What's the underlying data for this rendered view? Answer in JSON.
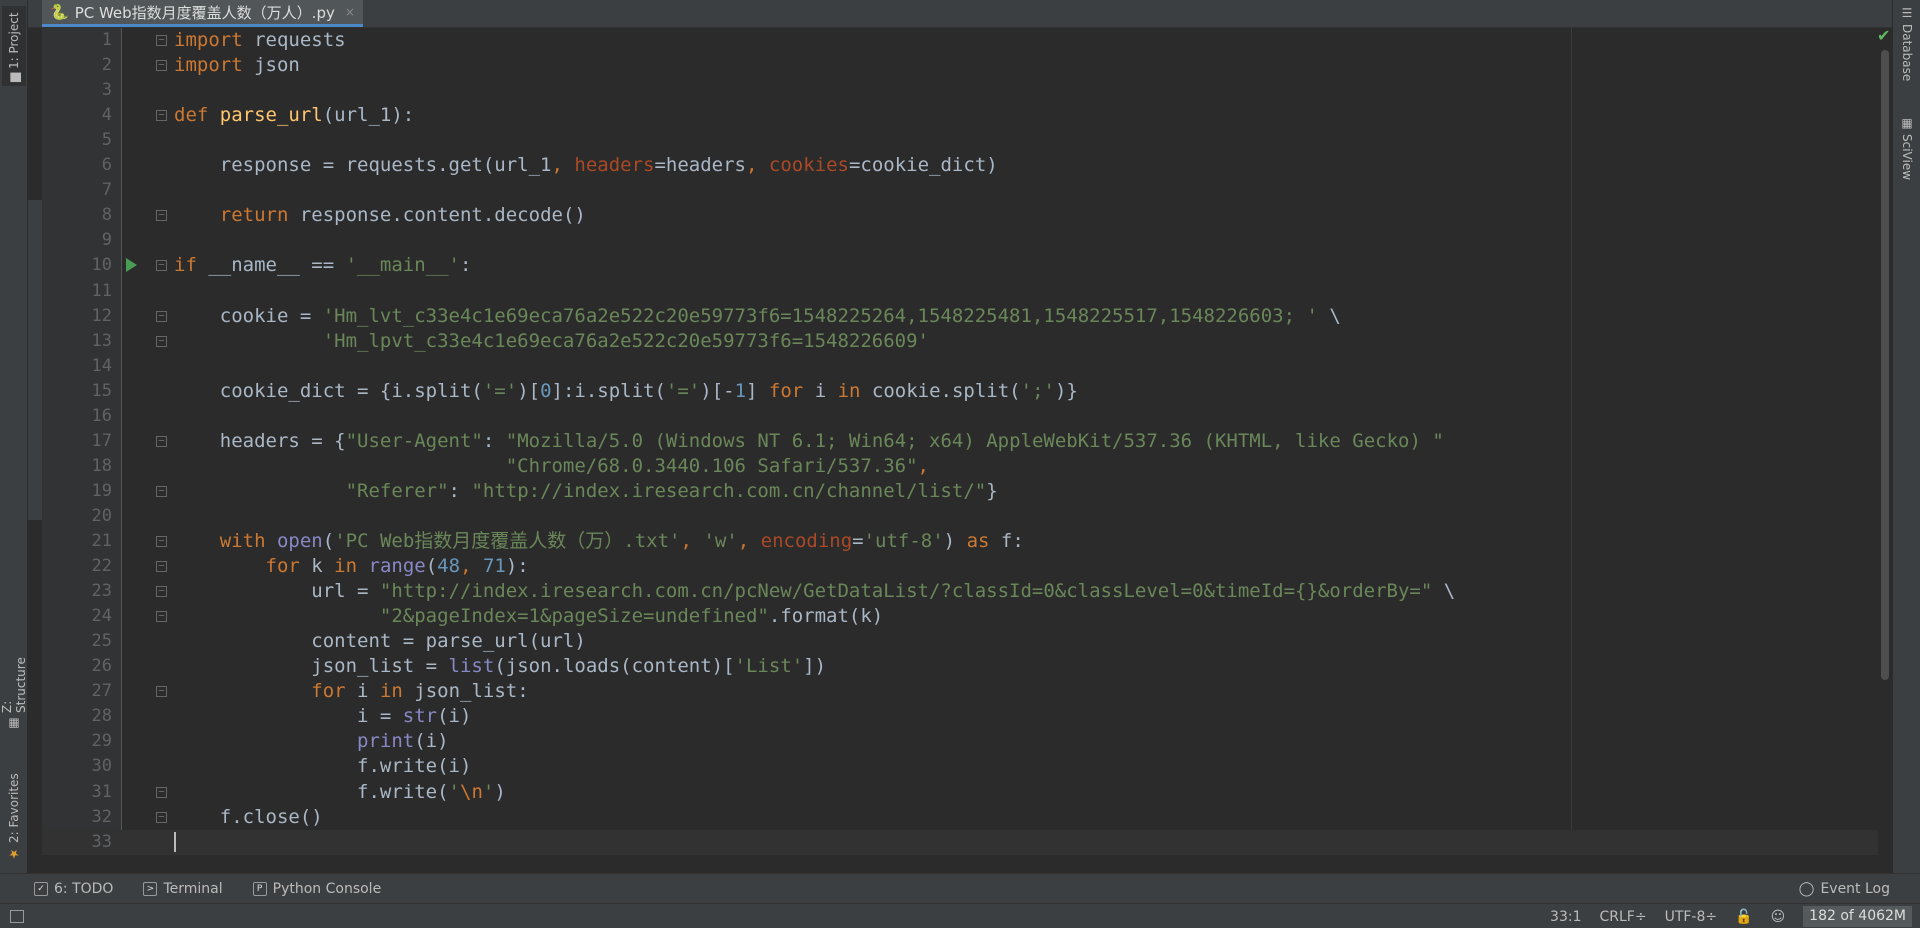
{
  "tab": {
    "title": "PC Web指数月度覆盖人数（万人）.py",
    "close": "×"
  },
  "left_tabs": {
    "project": "1: Project",
    "structure": "Z: Structure",
    "favorites": "2: Favorites"
  },
  "right_tabs": {
    "database": "Database",
    "sciview": "SciView"
  },
  "lines": [
    {
      "n": "1",
      "fold": true,
      "html": "<span class=\"kw\">import</span> requests"
    },
    {
      "n": "2",
      "fold": true,
      "html": "<span class=\"kw\">import</span> json"
    },
    {
      "n": "3",
      "html": ""
    },
    {
      "n": "4",
      "fold": true,
      "html": "<span class=\"kw\">def</span> <span class=\"fn\">parse_url</span>(url_1):"
    },
    {
      "n": "5",
      "html": ""
    },
    {
      "n": "6",
      "html": "    response = requests.get(url_1<span class=\"kw\">,</span> <span class=\"param\">headers</span>=headers<span class=\"kw\">,</span> <span class=\"param\">cookies</span>=cookie_dict)"
    },
    {
      "n": "7",
      "html": ""
    },
    {
      "n": "8",
      "fold": true,
      "html": "    <span class=\"kw\">return</span> response.content.decode()"
    },
    {
      "n": "9",
      "html": ""
    },
    {
      "n": "10",
      "fold": true,
      "run": true,
      "html": "<span class=\"kw\">if</span> __name__ == <span class=\"str\">'__main__'</span>:"
    },
    {
      "n": "11",
      "html": ""
    },
    {
      "n": "12",
      "fold": true,
      "html": "    cookie = <span class=\"str\">'Hm_lvt_c33e4c1e69eca76a2e522c20e59773f6=1548225264,1548225481,1548225517,1548226603; '</span> \\"
    },
    {
      "n": "13",
      "fold": true,
      "html": "             <span class=\"str\">'Hm_lpvt_c33e4c1e69eca76a2e522c20e59773f6=1548226609'</span>"
    },
    {
      "n": "14",
      "html": ""
    },
    {
      "n": "15",
      "html": "    cookie_dict = {i.split(<span class=\"str\">'='</span>)[<span class=\"num\">0</span>]:i.split(<span class=\"str\">'='</span>)[-<span class=\"num\">1</span>] <span class=\"kw\">for</span> i <span class=\"kw\">in</span> cookie.split(<span class=\"str\">';'</span>)}"
    },
    {
      "n": "16",
      "html": ""
    },
    {
      "n": "17",
      "fold": true,
      "html": "    headers = {<span class=\"str\">\"User-Agent\"</span>: <span class=\"str\">\"Mozilla/5.0 (Windows NT 6.1; Win64; x64) AppleWebKit/537.36 (KHTML, like Gecko) \"</span>"
    },
    {
      "n": "18",
      "html": "                             <span class=\"str\">\"Chrome/68.0.3440.106 Safari/537.36\"</span><span class=\"kw\">,</span>"
    },
    {
      "n": "19",
      "fold": true,
      "html": "               <span class=\"str\">\"Referer\"</span>: <span class=\"str\">\"http://index.iresearch.com.cn/channel/list/\"</span>}"
    },
    {
      "n": "20",
      "html": ""
    },
    {
      "n": "21",
      "fold": true,
      "html": "    <span class=\"kw\">with</span> <span class=\"bi\">open</span>(<span class=\"str\">'PC Web指数月度覆盖人数（万）.txt'</span><span class=\"kw\">,</span> <span class=\"str\">'w'</span><span class=\"kw\">,</span> <span class=\"param\">encoding</span>=<span class=\"str\">'utf-8'</span>) <span class=\"kw\">as</span> f:"
    },
    {
      "n": "22",
      "fold": true,
      "html": "        <span class=\"kw\">for</span> k <span class=\"kw\">in</span> <span class=\"bi\">range</span>(<span class=\"num\">48</span><span class=\"kw\">,</span> <span class=\"num\">71</span>):"
    },
    {
      "n": "23",
      "fold": true,
      "html": "            url = <span class=\"str\">\"http://index.iresearch.com.cn/pcNew/GetDataList/?classId=0&amp;classLevel=0&amp;timeId={}&amp;orderBy=\"</span> \\"
    },
    {
      "n": "24",
      "fold": true,
      "html": "                  <span class=\"str\">\"2&amp;pageIndex=1&amp;pageSize=undefined\"</span>.format(k)"
    },
    {
      "n": "25",
      "html": "            content = parse_url(url)"
    },
    {
      "n": "26",
      "html": "            json_list = <span class=\"bi\">list</span>(json.loads(content)[<span class=\"str\">'List'</span>])"
    },
    {
      "n": "27",
      "fold": true,
      "html": "            <span class=\"kw\">for</span> i <span class=\"kw\">in</span> json_list:"
    },
    {
      "n": "28",
      "html": "                i = <span class=\"bi\">str</span>(i)"
    },
    {
      "n": "29",
      "html": "                <span class=\"bi\">print</span>(i)"
    },
    {
      "n": "30",
      "html": "                f.write(i)"
    },
    {
      "n": "31",
      "fold": true,
      "html": "                f.write(<span class=\"str\">'<span class=\"esc\">\\n</span>'</span>)"
    },
    {
      "n": "32",
      "fold": true,
      "html": "    f.close()"
    },
    {
      "n": "33",
      "current": true,
      "html": "<span class=\"caret\"></span>"
    }
  ],
  "toolbar": {
    "todo": "6: TODO",
    "terminal": "Terminal",
    "python_console": "Python Console",
    "event_log": "Event Log"
  },
  "status": {
    "position": "33:1",
    "line_sep": "CRLF÷",
    "encoding": "UTF-8÷",
    "memory": "182 of 4062M"
  },
  "colors": {
    "background": "#2b2b2b",
    "keyword": "#cc7832",
    "string": "#6a8759",
    "number": "#6897bb",
    "builtin": "#8888c6",
    "param": "#aa4926"
  }
}
